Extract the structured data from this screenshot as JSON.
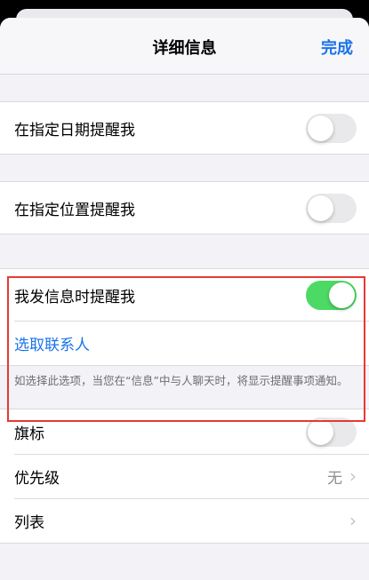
{
  "nav": {
    "title": "详细信息",
    "done_label": "完成"
  },
  "rows": {
    "date_label": "在指定日期提醒我",
    "date_on": false,
    "location_label": "在指定位置提醒我",
    "location_on": false,
    "message_label": "我发信息时提醒我",
    "message_on": true,
    "choose_contact_label": "选取联系人",
    "message_note": "如选择此选项，当您在“信息”中与人聊天时，将显示提醒事项通知。",
    "flag_label": "旗标",
    "flag_on": false,
    "priority_label": "优先级",
    "priority_value": "无",
    "list_label": "列表"
  },
  "colors": {
    "accent": "#1a73e8",
    "toggle_on": "#4cd964",
    "highlight_border": "#e53935"
  },
  "icons": {
    "chevron": "chevron-right-icon"
  }
}
